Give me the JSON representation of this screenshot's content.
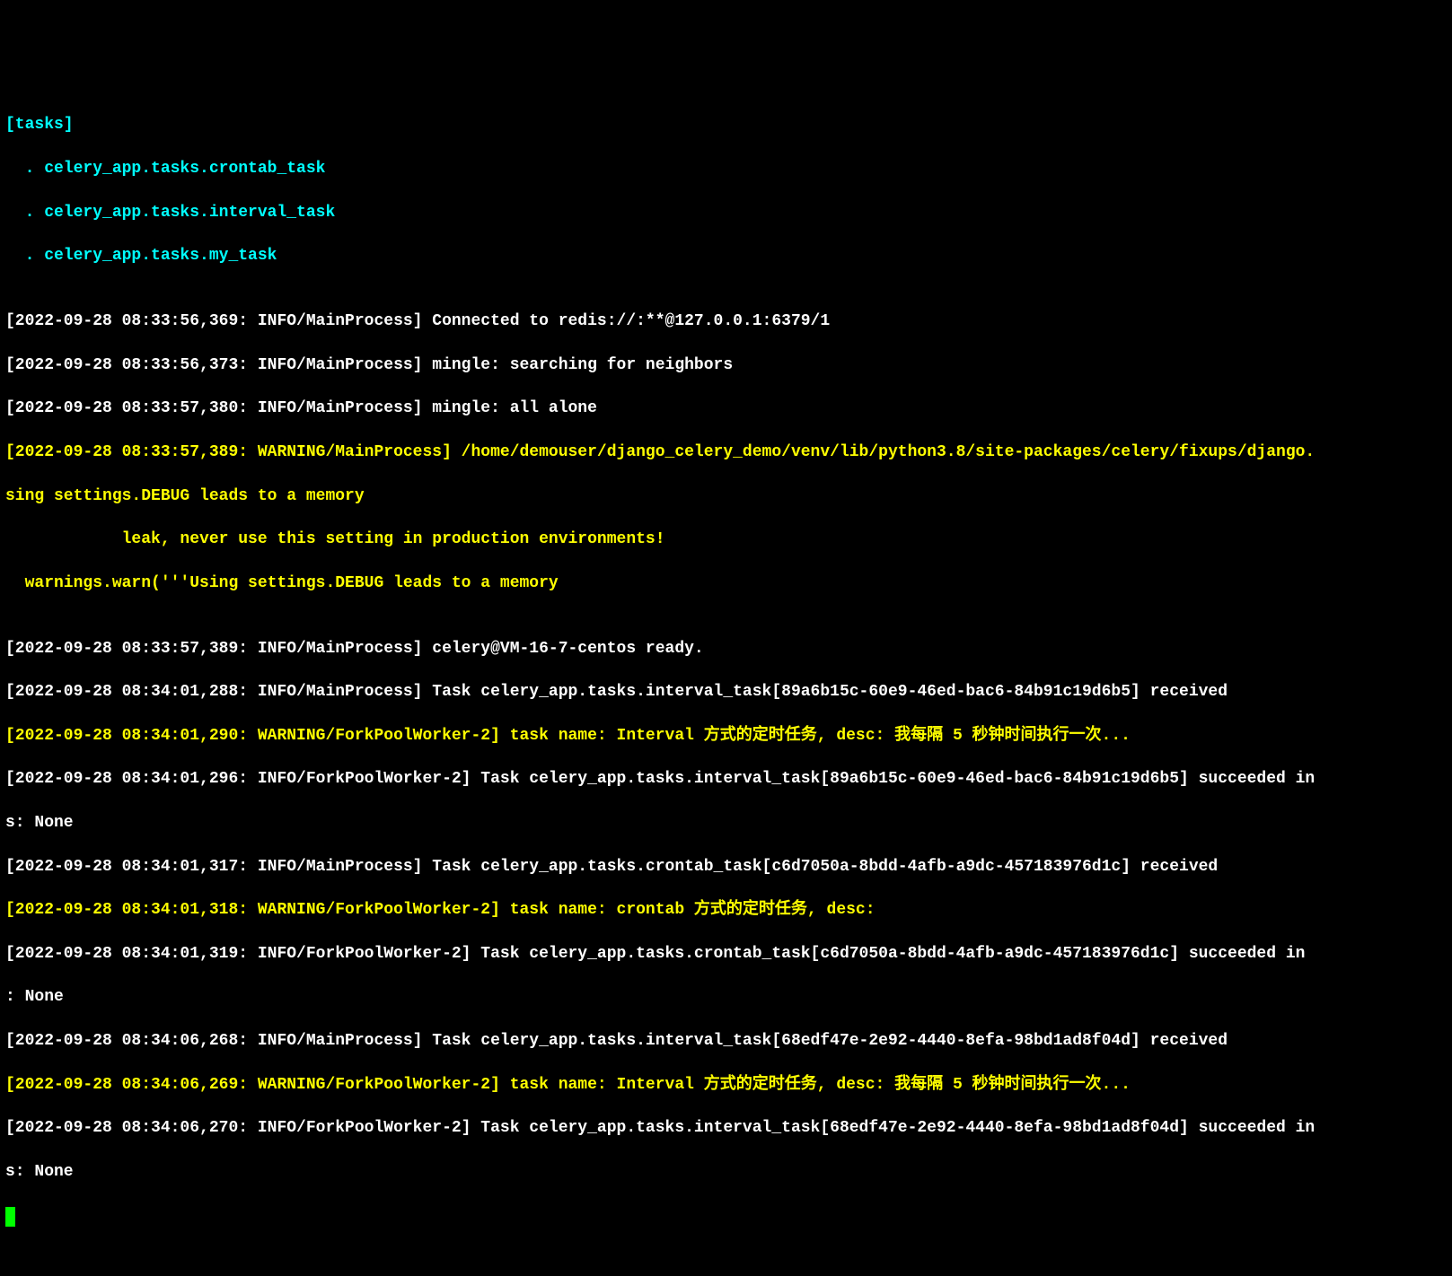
{
  "tasks_header": "[tasks]",
  "tasks": [
    "  . celery_app.tasks.crontab_task",
    "  . celery_app.tasks.interval_task",
    "  . celery_app.tasks.my_task"
  ],
  "blank": "",
  "lines": [
    {
      "class": "white",
      "text": "[2022-09-28 08:33:56,369: INFO/MainProcess] Connected to redis://:**@127.0.0.1:6379/1"
    },
    {
      "class": "white",
      "text": "[2022-09-28 08:33:56,373: INFO/MainProcess] mingle: searching for neighbors"
    },
    {
      "class": "white",
      "text": "[2022-09-28 08:33:57,380: INFO/MainProcess] mingle: all alone"
    },
    {
      "class": "yellow",
      "text": "[2022-09-28 08:33:57,389: WARNING/MainProcess] /home/demouser/django_celery_demo/venv/lib/python3.8/site-packages/celery/fixups/django."
    },
    {
      "class": "yellow",
      "text": "sing settings.DEBUG leads to a memory"
    },
    {
      "class": "yellow",
      "text": "            leak, never use this setting in production environments!"
    },
    {
      "class": "yellow",
      "text": "  warnings.warn('''Using settings.DEBUG leads to a memory"
    },
    {
      "class": "white",
      "text": ""
    },
    {
      "class": "white",
      "text": "[2022-09-28 08:33:57,389: INFO/MainProcess] celery@VM-16-7-centos ready."
    },
    {
      "class": "white",
      "text": "[2022-09-28 08:34:01,288: INFO/MainProcess] Task celery_app.tasks.interval_task[89a6b15c-60e9-46ed-bac6-84b91c19d6b5] received"
    },
    {
      "class": "yellow",
      "text": "[2022-09-28 08:34:01,290: WARNING/ForkPoolWorker-2] task name: Interval 方式的定时任务, desc: 我每隔 5 秒钟时间执行一次..."
    },
    {
      "class": "white",
      "text": "[2022-09-28 08:34:01,296: INFO/ForkPoolWorker-2] Task celery_app.tasks.interval_task[89a6b15c-60e9-46ed-bac6-84b91c19d6b5] succeeded in"
    },
    {
      "class": "white",
      "text": "s: None"
    },
    {
      "class": "white",
      "text": "[2022-09-28 08:34:01,317: INFO/MainProcess] Task celery_app.tasks.crontab_task[c6d7050a-8bdd-4afb-a9dc-457183976d1c] received"
    },
    {
      "class": "yellow",
      "text": "[2022-09-28 08:34:01,318: WARNING/ForkPoolWorker-2] task name: crontab 方式的定时任务, desc:"
    },
    {
      "class": "white",
      "text": "[2022-09-28 08:34:01,319: INFO/ForkPoolWorker-2] Task celery_app.tasks.crontab_task[c6d7050a-8bdd-4afb-a9dc-457183976d1c] succeeded in "
    },
    {
      "class": "white",
      "text": ": None"
    },
    {
      "class": "white",
      "text": "[2022-09-28 08:34:06,268: INFO/MainProcess] Task celery_app.tasks.interval_task[68edf47e-2e92-4440-8efa-98bd1ad8f04d] received"
    },
    {
      "class": "yellow",
      "text": "[2022-09-28 08:34:06,269: WARNING/ForkPoolWorker-2] task name: Interval 方式的定时任务, desc: 我每隔 5 秒钟时间执行一次..."
    },
    {
      "class": "white",
      "text": "[2022-09-28 08:34:06,270: INFO/ForkPoolWorker-2] Task celery_app.tasks.interval_task[68edf47e-2e92-4440-8efa-98bd1ad8f04d] succeeded in"
    },
    {
      "class": "white",
      "text": "s: None"
    }
  ]
}
